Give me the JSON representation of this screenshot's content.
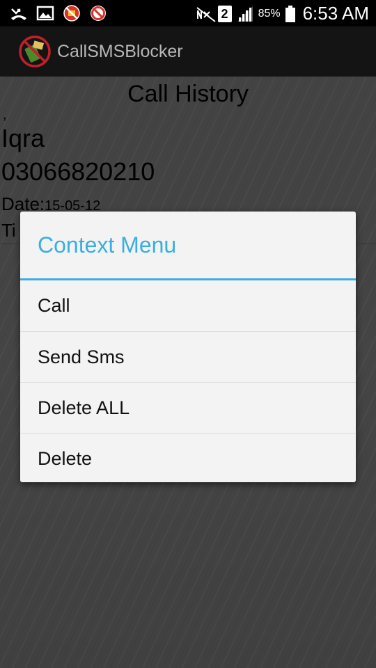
{
  "status_bar": {
    "icons": [
      "missed-call-icon",
      "image-icon",
      "blocked-icon",
      "blocked-icon",
      "no-signal-icon",
      "cell-signal-icon",
      "battery-icon"
    ],
    "sim_slot": "2",
    "battery_percent": "85%",
    "time": "6:53 AM"
  },
  "app": {
    "title": "CallSMSBlocker"
  },
  "page": {
    "title": "Call History"
  },
  "record": {
    "separator": ",",
    "name": "Iqra",
    "number": "03066820210",
    "date_label": "Date:",
    "date_value": "15-05-12",
    "time_label": "Ti"
  },
  "context_menu": {
    "title": "Context Menu",
    "items": [
      {
        "label": "Call"
      },
      {
        "label": "Send Sms"
      },
      {
        "label": "Delete ALL"
      },
      {
        "label": "Delete"
      }
    ]
  },
  "colors": {
    "accent": "#3aaee0",
    "actionbar": "#141414",
    "dialog_bg": "#f3f3f3"
  }
}
